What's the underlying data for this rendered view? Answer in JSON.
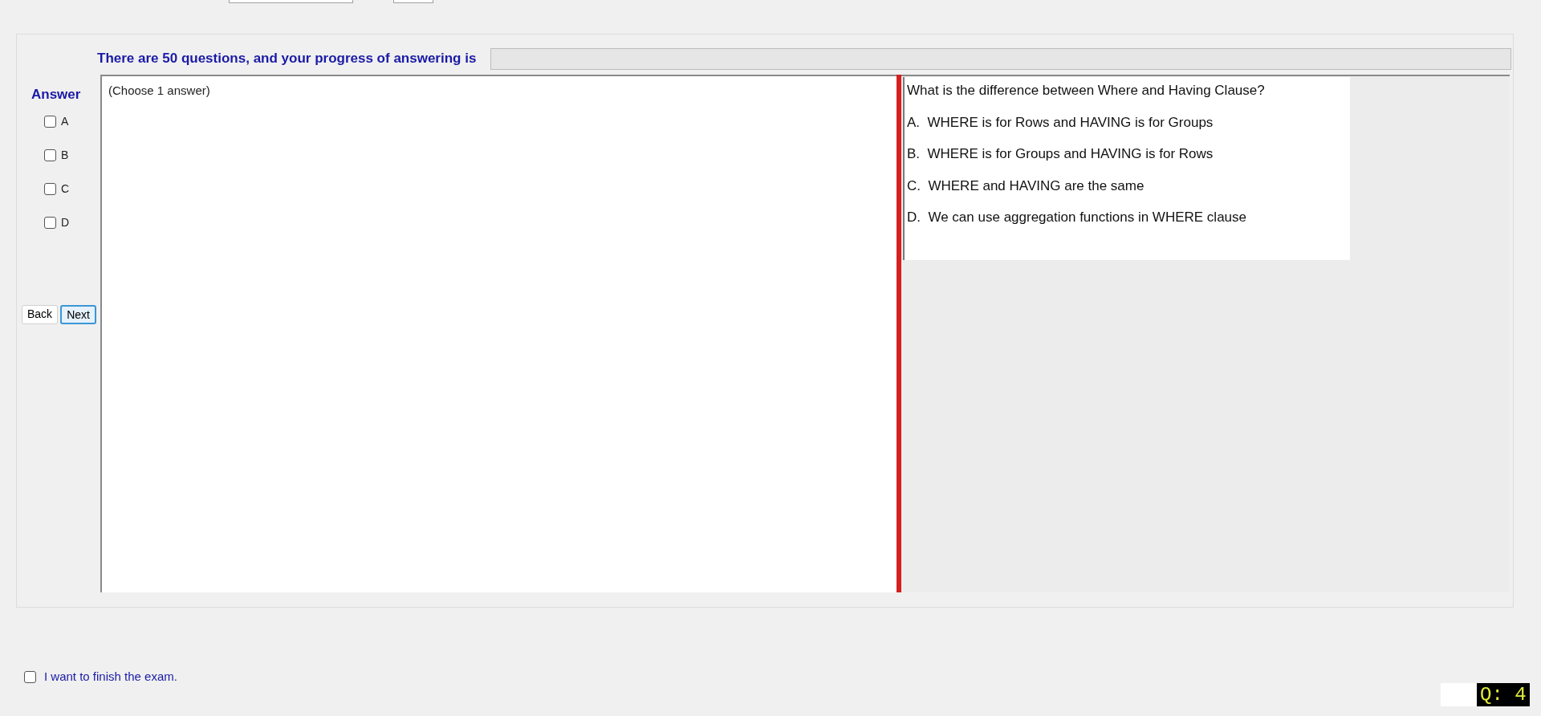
{
  "progress": {
    "label": "There are 50 questions, and your progress of answering is",
    "level": 0
  },
  "answer_panel": {
    "title": "Answer",
    "options": [
      {
        "label": "A",
        "checked": false
      },
      {
        "label": "B",
        "checked": false
      },
      {
        "label": "C",
        "checked": false
      },
      {
        "label": "D",
        "checked": false
      }
    ]
  },
  "buttons": [
    {
      "label": "Back",
      "selected": false
    },
    {
      "label": "Next",
      "selected": true
    }
  ],
  "answer_area": {
    "hint": "(Choose 1 answer)"
  },
  "question": {
    "text": "What is the difference between Where and Having Clause?",
    "choices": [
      "A.  WHERE is for Rows and HAVING is for Groups",
      "B.  WHERE is for Groups and HAVING is for Rows",
      "C.  WHERE and HAVING are the same",
      "D.  We can use aggregation functions in WHERE clause"
    ]
  },
  "finish": {
    "label": "I want to finish the exam.",
    "checked": false
  },
  "question_counter": "Q: 4"
}
